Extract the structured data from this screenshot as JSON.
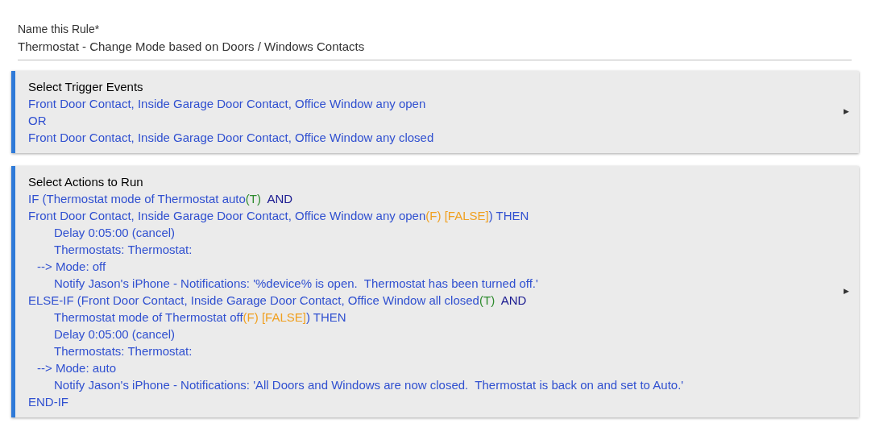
{
  "rule_name": {
    "label": "Name this Rule*",
    "value": "Thermostat - Change Mode based on Doors / Windows Contacts"
  },
  "sections": [
    {
      "title": "Select Trigger Events",
      "expand_icon": "▶",
      "lines": [
        {
          "kind": "condition",
          "segments": [
            {
              "kind": "plain",
              "text": "Front Door Contact, Inside Garage Door Contact, Office Window any open"
            }
          ]
        },
        {
          "kind": "condition",
          "segments": [
            {
              "kind": "plain",
              "text": "OR"
            }
          ]
        },
        {
          "kind": "condition",
          "segments": [
            {
              "kind": "plain",
              "text": "Front Door Contact, Inside Garage Door Contact, Office Window any closed"
            }
          ]
        }
      ]
    },
    {
      "title": "Select Actions to Run",
      "expand_icon": "▶",
      "lines": [
        {
          "kind": "condition",
          "segments": [
            {
              "kind": "plain",
              "text": "IF (Thermostat mode of Thermostat auto"
            },
            {
              "kind": "true",
              "text": "(T)"
            },
            {
              "kind": "keyword",
              "text": "  AND"
            }
          ]
        },
        {
          "kind": "condition",
          "segments": [
            {
              "kind": "plain",
              "text": "Front Door Contact, Inside Garage Door Contact, Office Window any open"
            },
            {
              "kind": "false",
              "text": "(F) [FALSE]"
            },
            {
              "kind": "plain",
              "text": ") THEN"
            }
          ]
        },
        {
          "kind": "action",
          "segments": [
            {
              "kind": "plain",
              "text": "Delay 0:05:00 (cancel)"
            }
          ]
        },
        {
          "kind": "action",
          "segments": [
            {
              "kind": "plain",
              "text": "Thermostats: Thermostat:"
            }
          ]
        },
        {
          "kind": "arrow",
          "segments": [
            {
              "kind": "plain",
              "text": "--> Mode: off"
            }
          ]
        },
        {
          "kind": "action",
          "segments": [
            {
              "kind": "plain",
              "text": "Notify Jason's iPhone - Notifications: '%device% is open.  Thermostat has been turned off.'"
            }
          ]
        },
        {
          "kind": "condition",
          "segments": [
            {
              "kind": "plain",
              "text": "ELSE-IF (Front Door Contact, Inside Garage Door Contact, Office Window all closed"
            },
            {
              "kind": "true",
              "text": "(T)"
            },
            {
              "kind": "keyword",
              "text": "  AND"
            }
          ]
        },
        {
          "kind": "action",
          "segments": [
            {
              "kind": "plain",
              "text": "Thermostat mode of Thermostat off"
            },
            {
              "kind": "false",
              "text": "(F) [FALSE]"
            },
            {
              "kind": "plain",
              "text": ") THEN"
            }
          ]
        },
        {
          "kind": "action",
          "segments": [
            {
              "kind": "plain",
              "text": "Delay 0:05:00 (cancel)"
            }
          ]
        },
        {
          "kind": "action",
          "segments": [
            {
              "kind": "plain",
              "text": "Thermostats: Thermostat:"
            }
          ]
        },
        {
          "kind": "arrow",
          "segments": [
            {
              "kind": "plain",
              "text": "--> Mode: auto"
            }
          ]
        },
        {
          "kind": "action",
          "segments": [
            {
              "kind": "plain",
              "text": "Notify Jason's iPhone - Notifications: 'All Doors and Windows are now closed.  Thermostat is back on and set to Auto.'"
            }
          ]
        },
        {
          "kind": "condition",
          "segments": [
            {
              "kind": "plain",
              "text": "END-IF"
            }
          ]
        }
      ]
    }
  ]
}
